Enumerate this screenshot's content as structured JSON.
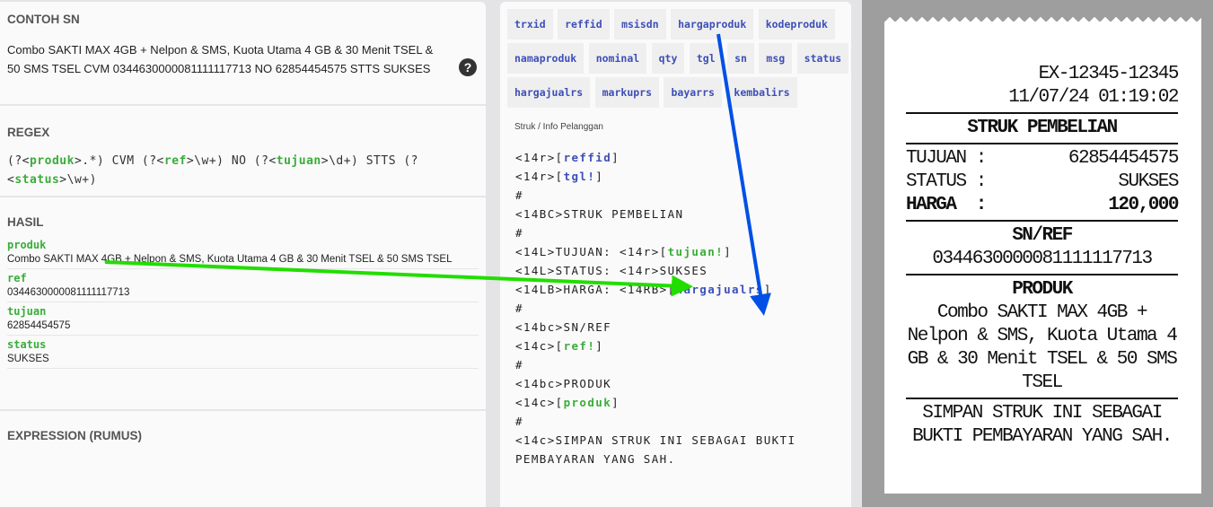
{
  "left": {
    "contoh_title": "CONTOH SN",
    "contoh_text": "Combo SAKTI MAX 4GB + Nelpon & SMS, Kuota Utama 4 GB & 30 Menit TSEL & 50 SMS TSEL CVM 0344630000081111117713 NO 62854454575 STTS SUKSES",
    "help_icon": "?",
    "regex_title": "REGEX",
    "regex": [
      "(?<",
      "produk",
      ">.*) CVM (?<",
      "ref",
      ">\\w+) NO (?<",
      "tujuan",
      ">\\d+) STTS (?<",
      "status",
      ">\\w+)"
    ],
    "hasil_title": "HASIL",
    "fields": [
      {
        "key": "produk",
        "value": "Combo SAKTI MAX 4GB + Nelpon & SMS, Kuota Utama 4 GB & 30 Menit TSEL & 50 SMS TSEL"
      },
      {
        "key": "ref",
        "value": "0344630000081111117713"
      },
      {
        "key": "tujuan",
        "value": "62854454575"
      },
      {
        "key": "status",
        "value": "SUKSES"
      }
    ],
    "expression_title": "EXPRESSION (RUMUS)"
  },
  "mid": {
    "chips": [
      "trxid",
      "reffid",
      "msisdn",
      "hargaproduk",
      "kodeproduk",
      "namaproduk",
      "nominal",
      "qty",
      "tgl",
      "sn",
      "msg",
      "status",
      "hargajualrs",
      "markuprs",
      "bayarrs",
      "kembalirs"
    ],
    "label": "Struk / Info Pelanggan",
    "template": [
      [
        "<14r>[",
        "reffid",
        "]",
        "b"
      ],
      [
        "<14r>[",
        "tgl!",
        "]",
        "b"
      ],
      [
        "#"
      ],
      [
        "<14BC>STRUK PEMBELIAN"
      ],
      [
        "#"
      ],
      [
        "<14L>TUJUAN: <14r>[",
        "tujuan!",
        "]",
        "g"
      ],
      [
        "<14L>STATUS: <14r>SUKSES"
      ],
      [
        "<14LB>HARGA: <14RB>[",
        "hargajualrs",
        "]",
        "b"
      ],
      [
        "#"
      ],
      [
        "<14bc>SN/REF"
      ],
      [
        "<14c>[",
        "ref!",
        "]",
        "g"
      ],
      [
        "#"
      ],
      [
        "<14bc>PRODUK"
      ],
      [
        "<14c>[",
        "produk",
        "]",
        "g"
      ],
      [
        "#"
      ],
      [
        "<14c>SIMPAN STRUK INI SEBAGAI BUKTI"
      ],
      [
        "PEMBAYARAN YANG SAH."
      ]
    ]
  },
  "receipt": {
    "id": "EX-12345-12345",
    "datetime": "11/07/24 01:19:02",
    "title": "STRUK PEMBELIAN",
    "rows": [
      {
        "k": "TUJUAN :",
        "v": "62854454575"
      },
      {
        "k": "STATUS :",
        "v": "SUKSES"
      },
      {
        "k": "HARGA  :",
        "v": "120,000"
      }
    ],
    "sn_title": "SN/REF",
    "sn": "0344630000081111117713",
    "produk_title": "PRODUK",
    "produk": "Combo SAKTI MAX 4GB + Nelpon & SMS, Kuota Utama 4 GB & 30 Menit TSEL & 50 SMS TSEL",
    "footer": "SIMPAN STRUK INI SEBAGAI BUKTI PEMBAYARAN YANG SAH."
  },
  "colors": {
    "green_arrow": "#22dd00",
    "blue_arrow": "#0050e6",
    "green": "#3aad3a",
    "blue": "#3d4fb8"
  }
}
